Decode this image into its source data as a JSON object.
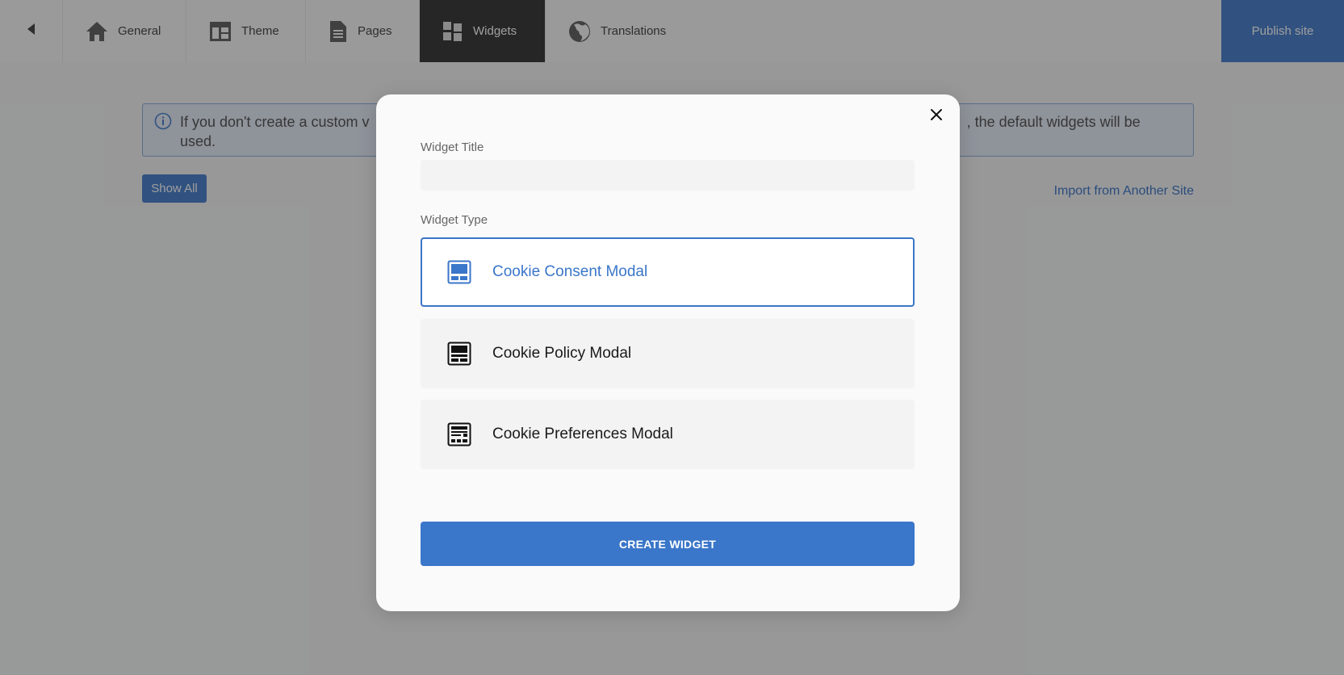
{
  "nav": {
    "tabs": [
      {
        "label": "General",
        "icon": "home-icon"
      },
      {
        "label": "Theme",
        "icon": "theme-layout-icon"
      },
      {
        "label": "Pages",
        "icon": "document-icon"
      },
      {
        "label": "Widgets",
        "icon": "widgets-icon",
        "active": true
      },
      {
        "label": "Translations",
        "icon": "globe-icon"
      }
    ],
    "publish_label": "Publish site"
  },
  "content": {
    "info_text": "If you don't create a custom v… , the default widgets will be used.",
    "info_text_left": "If you don't create a custom v",
    "info_text_right": ", the default widgets will be",
    "info_text_line2": "used.",
    "show_all_label": "Show All",
    "import_label": "Import from Another Site"
  },
  "modal": {
    "title_label": "Widget Title",
    "title_value": "",
    "type_label": "Widget Type",
    "types": [
      {
        "label": "Cookie Consent Modal",
        "icon": "consent-modal-icon",
        "selected": true
      },
      {
        "label": "Cookie Policy Modal",
        "icon": "policy-modal-icon",
        "selected": false
      },
      {
        "label": "Cookie Preferences Modal",
        "icon": "preferences-modal-icon",
        "selected": false
      }
    ],
    "create_label": "CREATE WIDGET"
  },
  "colors": {
    "accent": "#3a76c9",
    "active_tab": "#262626"
  }
}
